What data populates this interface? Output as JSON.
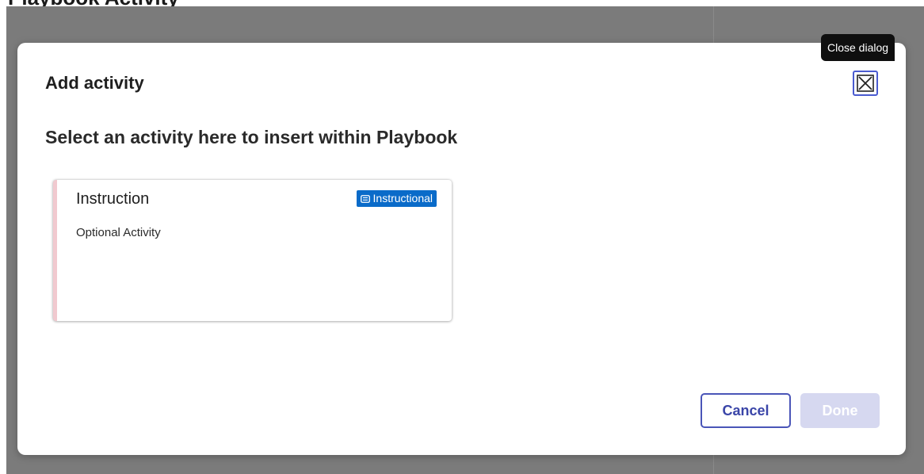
{
  "background": {
    "title_fragment": "Playbook Activity"
  },
  "dialog": {
    "title": "Add activity",
    "subtitle": "Select an activity here to insert within Playbook",
    "close_tooltip": "Close dialog",
    "close_icon": "close-icon",
    "activities": [
      {
        "title": "Instruction",
        "description": "Optional Activity",
        "badge_label": "Instructional",
        "badge_icon": "instructional-icon",
        "accent_color": "#f1c9cf"
      }
    ],
    "buttons": {
      "cancel_label": "Cancel",
      "done_label": "Done",
      "done_disabled": true
    }
  },
  "colors": {
    "overlay": "#7b7b7b",
    "primary": "#4a55b8",
    "badge": "#0a6bc9",
    "done_disabled": "#d6d8f0"
  }
}
